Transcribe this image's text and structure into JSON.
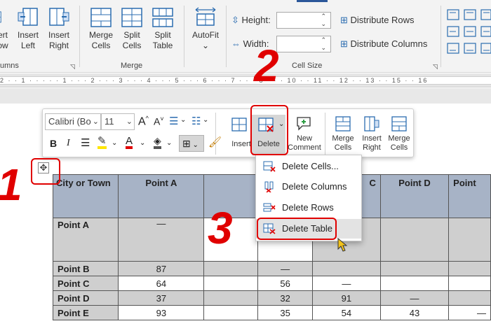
{
  "ribbon": {
    "rows_cols": [
      {
        "l1": "ert",
        "l2": "ow"
      },
      {
        "l1": "Insert",
        "l2": "Left"
      },
      {
        "l1": "Insert",
        "l2": "Right"
      }
    ],
    "rows_cols_group": "umns",
    "merge": [
      {
        "l1": "Merge",
        "l2": "Cells"
      },
      {
        "l1": "Split",
        "l2": "Cells"
      },
      {
        "l1": "Split",
        "l2": "Table"
      }
    ],
    "merge_group": "Merge",
    "autofit": "AutoFit",
    "height_label": "Height:",
    "width_label": "Width:",
    "cell_size_group": "Cell Size",
    "distribute_rows": "Distribute Rows",
    "distribute_columns": "Distribute Columns"
  },
  "ruler": {
    "ticks": "2 · · 1 · · · · · 1 · · · 2 · · · 3 · · · 4 · · · 5 · · · 6 · · · 7 · · · 8 · · · 10 · · 11 · · 12 · · 13 · · 15 · · 16"
  },
  "minitoolbar": {
    "font": "Calibri (Bo",
    "size": "11",
    "insert": "Insert",
    "delete": "Delete",
    "new_comment": {
      "l1": "New",
      "l2": "Comment"
    },
    "merge_cells": {
      "l1": "Merge",
      "l2": "Cells"
    },
    "insert_right": {
      "l1": "Insert",
      "l2": "Right"
    },
    "merge_cells2": {
      "l1": "Merge",
      "l2": "Cells"
    }
  },
  "delete_menu": {
    "items": [
      {
        "label": "Delete Cells..."
      },
      {
        "label": "Delete Columns"
      },
      {
        "label": "Delete Rows"
      },
      {
        "label": "Delete Table"
      }
    ]
  },
  "table": {
    "headers": [
      "City or Town",
      "Point A",
      "",
      "",
      "C",
      "Point D",
      "Point"
    ],
    "rows": [
      [
        "Point A",
        "—",
        "",
        "",
        "",
        "",
        ""
      ],
      [
        "Point B",
        "87",
        "",
        "—",
        "",
        "",
        ""
      ],
      [
        "Point C",
        "64",
        "",
        "56",
        "—",
        "",
        ""
      ],
      [
        "Point D",
        "37",
        "",
        "32",
        "91",
        "—",
        ""
      ],
      [
        "Point E",
        "93",
        "",
        "35",
        "54",
        "43",
        "—"
      ]
    ]
  },
  "callouts": [
    "1",
    "2",
    "3"
  ],
  "colors": {
    "callout": "#e00000",
    "header_fill": "#a7b3c6",
    "row_fill": "#cfcfcf",
    "accent": "#2b579a"
  }
}
